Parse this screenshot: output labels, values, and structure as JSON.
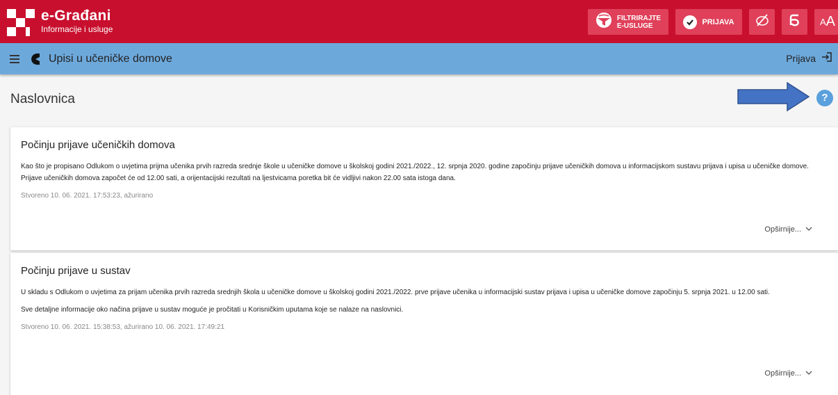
{
  "header": {
    "logo_title": "e-Građani",
    "logo_subtitle": "Informacije i usluge",
    "filter_label_line1": "FILTRIRAJTE",
    "filter_label_line2": "E-USLUGE",
    "login_label": "PRIJAVA",
    "font_size_label_small": "A",
    "font_size_label_large": "A"
  },
  "nav": {
    "title": "Upisi u učeničke domove",
    "login_label": "Prijava"
  },
  "page": {
    "title": "Naslovnica",
    "help_label": "?"
  },
  "articles": [
    {
      "title": "Počinju prijave učeničkih domova",
      "paragraphs": [
        "Kao što je propisano Odlukom o uvjetima prijma učenika prvih razreda srednje škole u učeničke domove u školskoj godini 2021./2022., 12. srpnja 2020. godine započinju prijave učeničkih domova u informacijskom sustavu prijava i upisa u učeničke domove. Prijave učeničkih domova započet će od 12.00 sati, a orijentacijski rezultati na ljestvicama poretka bit će vidljivi nakon 22.00 sata istoga dana."
      ],
      "meta": "Stvoreno 10. 06. 2021. 17:53:23, ažurirano",
      "more_label": "Opširnije..."
    },
    {
      "title": "Počinju prijave u sustav",
      "paragraphs": [
        "U skladu s Odlukom o uvjetima za prijam učenika prvih razreda srednjih škola u učeničke domove u školskoj godini 2021./2022. prve prijave učenika u informacijski sustav prijava i upisa u učeničke domove započinju 5. srpnja 2021. u 12.00 sati.",
        "Sve detaljne informacije oko načina prijave u sustav moguće je pročitati u Korisničkim uputama koje se nalaze na naslovnici."
      ],
      "meta": "Stvoreno 10. 06. 2021. 15:38:53, ažurirano 10. 06. 2021. 17:49:21",
      "more_label": "Opširnije..."
    }
  ],
  "colors": {
    "header_red": "#c8102e",
    "header_button": "#e0405a",
    "nav_blue": "#6da8db",
    "help_blue": "#5aa0dc",
    "arrow_blue": "#4472c4"
  },
  "icons": {
    "filter": "globe-filter-icon",
    "login": "check-circle-icon",
    "visibility": "eye-slash-icon",
    "script": "glagolitic-letter-icon",
    "menu": "hamburger-icon",
    "nav_logo": "pacman-icon",
    "login_nav": "login-icon",
    "help": "help-icon",
    "more": "chevron-down-icon"
  }
}
